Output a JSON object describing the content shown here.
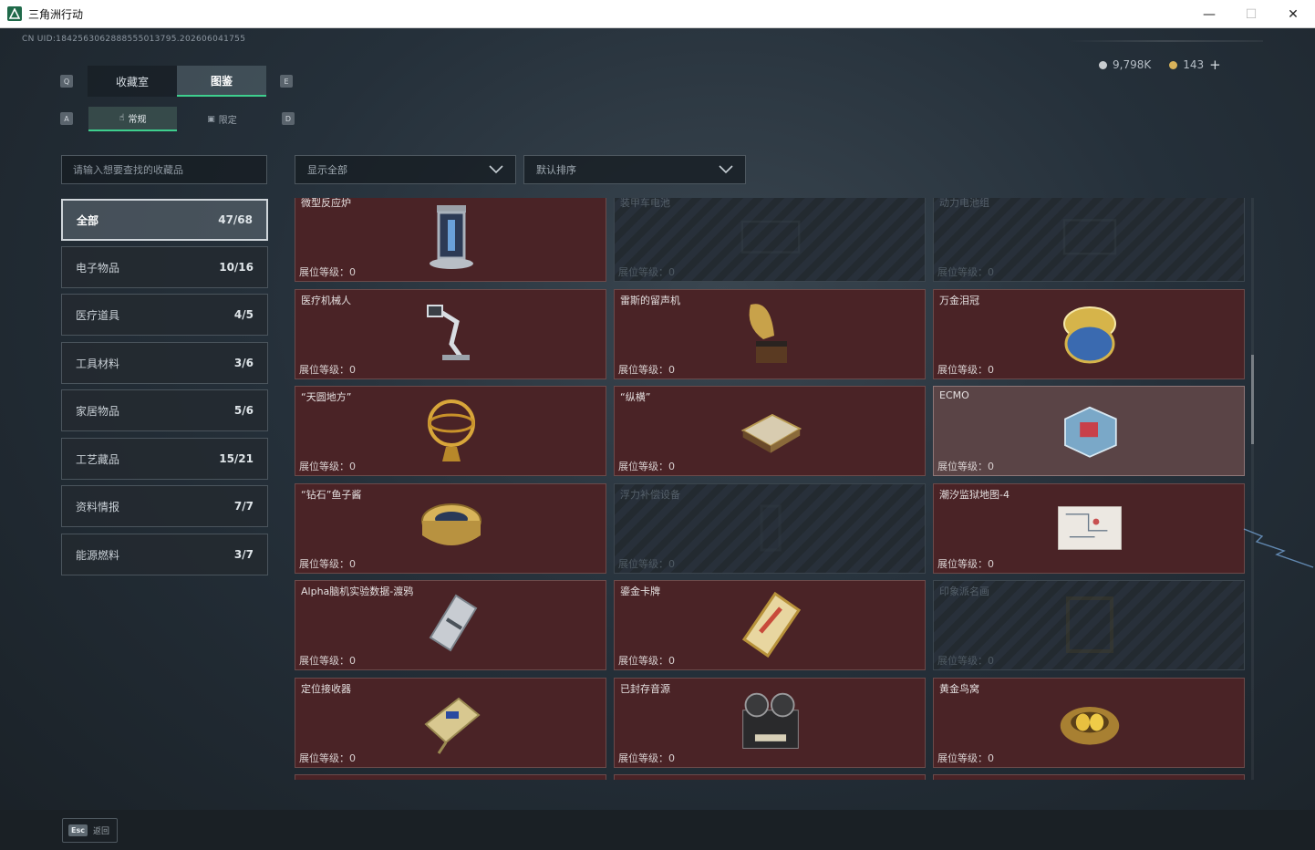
{
  "window": {
    "title": "三角洲行动",
    "minimize_glyph": "—",
    "maximize_glyph": "☐",
    "close_glyph": "✕"
  },
  "header": {
    "uid": "CN UID:1842563062888555013795.202606041755"
  },
  "currency": [
    {
      "icon": "silver-coin-icon",
      "color": "#c8ccd0",
      "value": "9,798K"
    },
    {
      "icon": "gold-coin-icon",
      "color": "#d8b25a",
      "value": "143"
    }
  ],
  "currency_add": "+",
  "key_hints": {
    "prev_tab": "Q",
    "next_tab": "E",
    "prev_subtab": "A",
    "next_subtab": "D"
  },
  "tabs": [
    {
      "label": "收藏室",
      "active": false
    },
    {
      "label": "图鉴",
      "active": true
    }
  ],
  "subtabs": [
    {
      "label": "常规",
      "icon": "hand-icon",
      "active": true
    },
    {
      "label": "限定",
      "icon": "frame-icon",
      "active": false
    }
  ],
  "search": {
    "placeholder": "请输入想要查找的收藏品"
  },
  "filter": {
    "value": "显示全部"
  },
  "sort": {
    "value": "默认排序"
  },
  "categories": [
    {
      "label": "全部",
      "count": "47/68",
      "active": true
    },
    {
      "label": "电子物品",
      "count": "10/16"
    },
    {
      "label": "医疗道具",
      "count": "4/5"
    },
    {
      "label": "工具材料",
      "count": "3/6"
    },
    {
      "label": "家居物品",
      "count": "5/6"
    },
    {
      "label": "工艺藏品",
      "count": "15/21"
    },
    {
      "label": "资料情报",
      "count": "7/7"
    },
    {
      "label": "能源燃料",
      "count": "3/7"
    }
  ],
  "items": [
    {
      "name": "微型反应炉",
      "level": "展位等级：0",
      "state": "collected",
      "icon": "reactor-icon"
    },
    {
      "name": "装甲车电池",
      "level": "展位等级：0",
      "state": "missing",
      "icon": "battery-icon"
    },
    {
      "name": "动力电池组",
      "level": "展位等级：0",
      "state": "missing",
      "icon": "battery-pack-icon"
    },
    {
      "name": "医疗机械人",
      "level": "展位等级：0",
      "state": "collected",
      "icon": "medical-robot-icon"
    },
    {
      "name": "雷斯的留声机",
      "level": "展位等级：0",
      "state": "collected",
      "icon": "gramophone-icon"
    },
    {
      "name": "万金泪冠",
      "level": "展位等级：0",
      "state": "collected",
      "icon": "jeweled-egg-icon"
    },
    {
      "name": "“天圆地方”",
      "level": "展位等级：0",
      "state": "collected",
      "icon": "armillary-sphere-icon"
    },
    {
      "name": "“纵横”",
      "level": "展位等级：0",
      "state": "collected",
      "icon": "chess-board-icon"
    },
    {
      "name": "ECMO",
      "level": "展位等级：0",
      "state": "selected",
      "icon": "ecmo-machine-icon"
    },
    {
      "name": "“钻石”鱼子酱",
      "level": "展位等级：0",
      "state": "collected",
      "icon": "caviar-tin-icon"
    },
    {
      "name": "浮力补偿设备",
      "level": "展位等级：0",
      "state": "missing",
      "icon": "buoyancy-device-icon"
    },
    {
      "name": "潮汐监狱地图-4",
      "level": "展位等级：0",
      "state": "collected",
      "icon": "map-icon"
    },
    {
      "name": "Alpha脑机实验数据-渡鸦",
      "level": "展位等级：0",
      "state": "collected",
      "icon": "data-canister-icon"
    },
    {
      "name": "鎏金卡牌",
      "level": "展位等级：0",
      "state": "collected",
      "icon": "gold-card-icon"
    },
    {
      "name": "印象派名画",
      "level": "展位等级：0",
      "state": "missing",
      "icon": "painting-frame-icon"
    },
    {
      "name": "定位接收器",
      "level": "展位等级：0",
      "state": "collected",
      "icon": "receiver-icon"
    },
    {
      "name": "已封存音源",
      "level": "展位等级：0",
      "state": "collected",
      "icon": "reel-recorder-icon"
    },
    {
      "name": "黄金鸟窝",
      "level": "展位等级：0",
      "state": "collected",
      "icon": "golden-nest-icon"
    }
  ],
  "footer": {
    "esc_key": "Esc",
    "esc_label": "返回"
  }
}
